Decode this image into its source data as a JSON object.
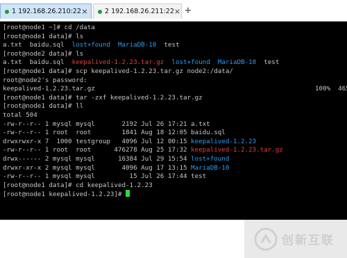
{
  "tabs": [
    {
      "label": "1 192.168.26.210:22",
      "close": "×",
      "color": "#1f9a3a"
    },
    {
      "label": "2 192.168.26.211:22",
      "close": "×",
      "color": "#1f9a3a"
    }
  ],
  "new_tab_label": "+",
  "terminal": {
    "l1": "[root@node1 ~]# cd /data",
    "l2": "[root@node1 data]# ls",
    "l3": {
      "a": "a.txt  baidu.sql  ",
      "b": "lost+found",
      "c": "  ",
      "d": "MariaDB-10",
      "e": "  test"
    },
    "l4": "[root@node2 data]# ls",
    "l5": {
      "a": "a.txt  baidu.sql  ",
      "b": "keepalived-1.2.23.tar.gz",
      "c": "  ",
      "d": "lost+found",
      "e": "  ",
      "f": "MariaDB-10",
      "g": "  test"
    },
    "l6": "[root@node1 data]# scp keepalived-1.2.23.tar.gz node2:/data/",
    "l7": "root@node2's password:",
    "l8": {
      "a": "keepalived-1.2.23.tar.gz",
      "b": "100%  465"
    },
    "l9": "[root@node1 data]# tar -zxf keepalived-1.2.23.tar.gz",
    "l10": "[root@node1 data]# ll",
    "l11": "total 504",
    "l12": "-rw-r--r-- 1 mysql mysql       2192 Jul 26 17:21 a.txt",
    "l13": "-rw-r--r-- 1 root  root        1841 Aug 18 12:05 baidu.sql",
    "l14": {
      "a": "drwxrwxr-x 7  1000 testgroup   4096 Jul 12 00:15 ",
      "b": "keepalived-1.2.23"
    },
    "l15": {
      "a": "-rw-r--r-- 1 root  root      476278 Aug 25 17:32 ",
      "b": "keepalived-1.2.23.tar.gz"
    },
    "l16": {
      "a": "drwx------ 2 mysql mysql      16384 Jul 29 15:54 ",
      "b": "lost+found"
    },
    "l17": {
      "a": "drwxr-xr-x 2 mysql mysql       4096 Aug 17 13:15 ",
      "b": "MariaDB-10"
    },
    "l18": "-rw-r--r-- 1 mysql mysql         15 Jul 26 17:44 test",
    "l19": "[root@node1 data]# cd keepalived-1.2.23",
    "l20": "[root@node1 keepalived-1.2.23]# "
  },
  "watermark": {
    "text": "创新互联",
    "icon": "chuangxin-logo-icon"
  },
  "colors": {
    "blue": "#2a9df4",
    "red": "#e0413a",
    "cursor": "#23e043",
    "tab_active_bg": "#cfe4f6"
  }
}
